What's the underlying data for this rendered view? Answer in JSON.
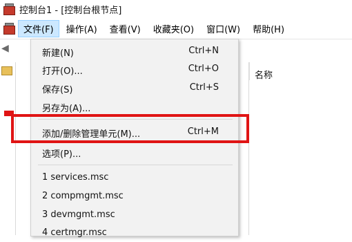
{
  "window": {
    "title": "控制台1 - [控制台根节点]"
  },
  "menubar": {
    "items": [
      {
        "label": "文件(F)",
        "active": true
      },
      {
        "label": "操作(A)"
      },
      {
        "label": "查看(V)"
      },
      {
        "label": "收藏夹(O)"
      },
      {
        "label": "窗口(W)"
      },
      {
        "label": "帮助(H)"
      }
    ]
  },
  "list": {
    "column_name": "名称"
  },
  "file_menu": {
    "new": {
      "label": "新建(N)",
      "shortcut": "Ctrl+N"
    },
    "open": {
      "label": "打开(O)...",
      "shortcut": "Ctrl+O"
    },
    "save": {
      "label": "保存(S)",
      "shortcut": "Ctrl+S"
    },
    "save_as": {
      "label": "另存为(A)..."
    },
    "add_remove_snapin": {
      "label": "添加/删除管理单元(M)...",
      "shortcut": "Ctrl+M"
    },
    "options": {
      "label": "选项(P)..."
    },
    "recent": [
      "1 services.msc",
      "2 compmgmt.msc",
      "3 devmgmt.msc",
      "4 certmgr.msc"
    ]
  },
  "colors": {
    "highlight": "#e01414",
    "menu_active": "#cce8ff"
  },
  "icons": {
    "app": "toolbox-icon",
    "back": "back-arrow-icon",
    "folder": "folder-icon"
  }
}
